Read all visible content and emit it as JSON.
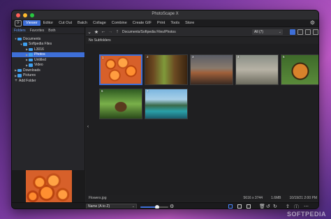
{
  "window": {
    "title": "PhotoScape X"
  },
  "menu": {
    "logo_glyph": "⟳",
    "items": [
      "Viewer",
      "Editor",
      "Cut Out",
      "Batch",
      "Collage",
      "Combine",
      "Create GIF",
      "Print",
      "Tools",
      "Store"
    ],
    "active": "Viewer"
  },
  "sidebar": {
    "tabs": [
      "Folders",
      "Favorites",
      "Both"
    ],
    "active_tab": "Folders",
    "tree": [
      {
        "label": "Documents",
        "level": 0,
        "expanded": true,
        "color": "blue"
      },
      {
        "label": "Softpedia Files",
        "level": 1,
        "expanded": true,
        "color": "blue"
      },
      {
        "label": "L3016",
        "level": 2,
        "expanded": false,
        "color": "blue"
      },
      {
        "label": "Photos",
        "level": 2,
        "expanded": false,
        "color": "blue",
        "selected": true
      },
      {
        "label": "Untitled",
        "level": 2,
        "expanded": false,
        "color": "blue"
      },
      {
        "label": "Video",
        "level": 2,
        "expanded": false,
        "color": "blue"
      },
      {
        "label": "Downloads",
        "level": 0,
        "expanded": false,
        "color": "blue"
      },
      {
        "label": "Pictures",
        "level": 0,
        "expanded": false,
        "color": "blue"
      },
      {
        "label": "Add Folder",
        "level": 0,
        "type": "add"
      }
    ]
  },
  "toolbar": {
    "breadcrumb": "Documents/Softpedia Files/Photos",
    "filter_value": "All (7)"
  },
  "browser": {
    "subfolders_text": "No Subfolders",
    "thumbnails": [
      {
        "num": "1",
        "cls": "img1",
        "selected": true
      },
      {
        "num": "2",
        "cls": "img2"
      },
      {
        "num": "3",
        "cls": "img3"
      },
      {
        "num": "4",
        "cls": "img4"
      },
      {
        "num": "5",
        "cls": "img5"
      },
      {
        "num": "6",
        "cls": "img6"
      },
      {
        "num": "7",
        "cls": "img7"
      }
    ]
  },
  "status": {
    "filename": "Flowers.jpg",
    "dimensions": "5616 x 3744",
    "filesize": "1.6MB",
    "date": "10/19/21 2:00 PM"
  },
  "bottom": {
    "sort_value": "Name (A to Z)",
    "zoom_level": 0.6
  },
  "watermark": "SOFTPEDIA",
  "colors": {
    "accent": "#3e6fd8"
  }
}
